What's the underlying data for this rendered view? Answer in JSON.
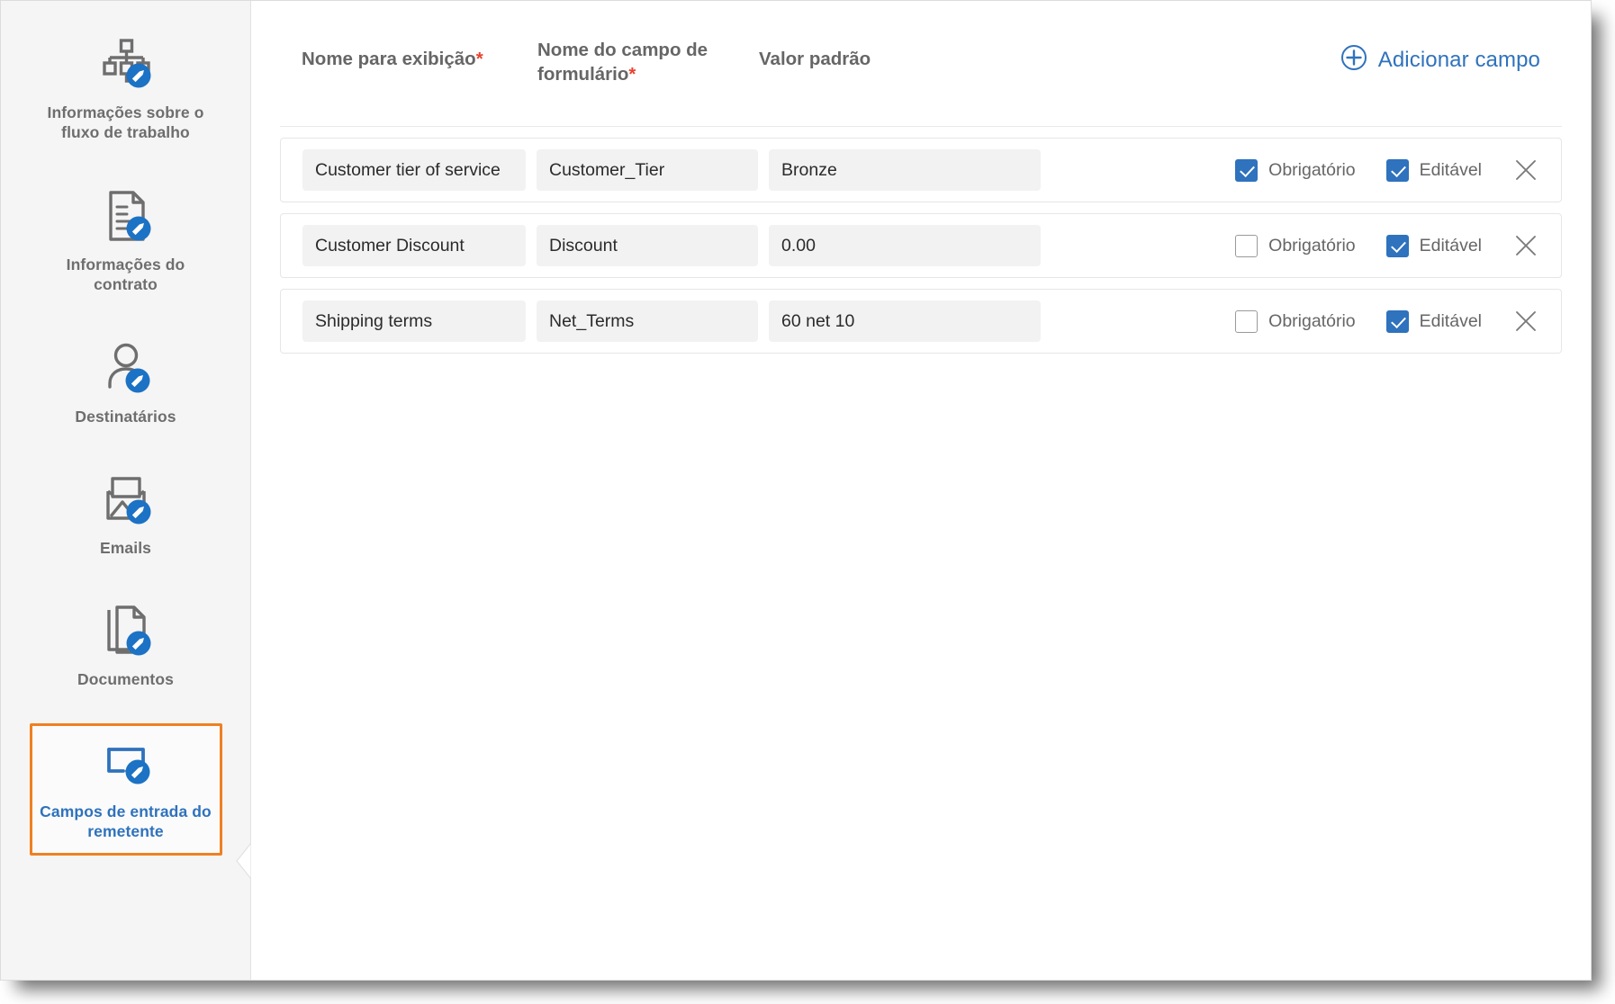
{
  "window": {
    "accent_blue": "#2f72bd",
    "active_highlight": "#ef8022",
    "required_asterisk_color": "#e8422f",
    "sidebar_bg": "#f5f5f5"
  },
  "sidebar": {
    "collapse_handle_icon": "chevron-left-icon",
    "items": [
      {
        "id": "workflow-info",
        "label": "Informações sobre o fluxo de trabalho",
        "icon": "org-chart-edit-icon",
        "active": false
      },
      {
        "id": "agreement-info",
        "label": "Informações do contrato",
        "icon": "document-edit-icon",
        "active": false
      },
      {
        "id": "recipients",
        "label": "Destinatários",
        "icon": "user-edit-icon",
        "active": false
      },
      {
        "id": "emails",
        "label": "Emails",
        "icon": "mail-image-edit-icon",
        "active": false
      },
      {
        "id": "documents",
        "label": "Documentos",
        "icon": "documents-edit-icon",
        "active": false
      },
      {
        "id": "sender-input-fields",
        "label": "Campos de entrada do remetente",
        "icon": "input-field-edit-icon",
        "active": true
      }
    ]
  },
  "main": {
    "columns": {
      "display_name": {
        "label": "Nome para exibição",
        "required_mark": "*"
      },
      "form_field_name": {
        "label": "Nome do campo de formulário",
        "required_mark": "*"
      },
      "default_value": {
        "label": "Valor padrão",
        "required_mark": ""
      }
    },
    "add_field": {
      "label": "Adicionar campo",
      "icon": "plus-circle-icon"
    },
    "toggles": {
      "required_label": "Obrigatório",
      "editable_label": "Editável",
      "remove_icon": "close-x-icon"
    },
    "placeholders": {
      "display_name": "Nome para exibição",
      "form_field_name": "Nome do campo de formulário",
      "default_value": "Valor padrão"
    },
    "rows": [
      {
        "display_name": "Customer tier of service",
        "form_field_name": "Customer_Tier",
        "default_value": "Bronze",
        "required": true,
        "editable": true
      },
      {
        "display_name": "Customer Discount",
        "form_field_name": "Discount",
        "default_value": "0.00",
        "required": false,
        "editable": true
      },
      {
        "display_name": "Shipping terms",
        "form_field_name": "Net_Terms",
        "default_value": "60 net 10",
        "required": false,
        "editable": true
      }
    ]
  }
}
